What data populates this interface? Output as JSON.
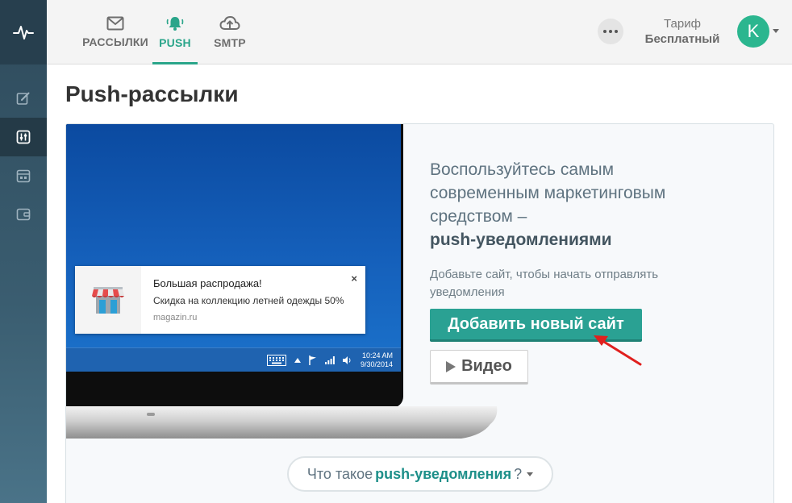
{
  "sidebar": {
    "logo_icon": "pulse-logo-icon",
    "items": [
      {
        "icon": "edit-icon",
        "active": false
      },
      {
        "icon": "sliders-icon",
        "active": true
      },
      {
        "icon": "calendar-icon",
        "active": false
      },
      {
        "icon": "wallet-icon",
        "active": false
      }
    ]
  },
  "header": {
    "tabs": [
      {
        "label": "РАССЫЛКИ",
        "icon": "mail-icon",
        "active": false
      },
      {
        "label": "PUSH",
        "icon": "bell-icon",
        "active": true
      },
      {
        "label": "SMTP",
        "icon": "cloud-upload-icon",
        "active": false
      }
    ],
    "more_icon": "more-dots-icon",
    "tariff_label": "Тариф",
    "tariff_value": "Бесплатный",
    "avatar_letter": "K"
  },
  "page": {
    "title": "Push-рассылки"
  },
  "illustration": {
    "notification": {
      "title": "Большая распродажа!",
      "body": "Скидка на коллекцию летней одежды 50%",
      "site": "magazin.ru",
      "close": "×"
    },
    "clock_time": "10:24 AM",
    "clock_date": "9/30/2014"
  },
  "promo": {
    "headline": "Воспользуйтесь самым современным маркетинговым средством –",
    "headline_bold": "push-уведомлениями",
    "subtext": "Добавьте сайт, чтобы начать отправлять уведомления",
    "add_site_button": "Добавить новый сайт",
    "video_button": "Видео"
  },
  "faq": {
    "prefix": "Что такое",
    "bold": "push-уведомления",
    "suffix": "?"
  },
  "colors": {
    "accent": "#2aa58a",
    "button": "#2aa193",
    "sidebar": "#2f4b5c",
    "avatar": "#2bb68f",
    "arrow": "#e0201e"
  }
}
